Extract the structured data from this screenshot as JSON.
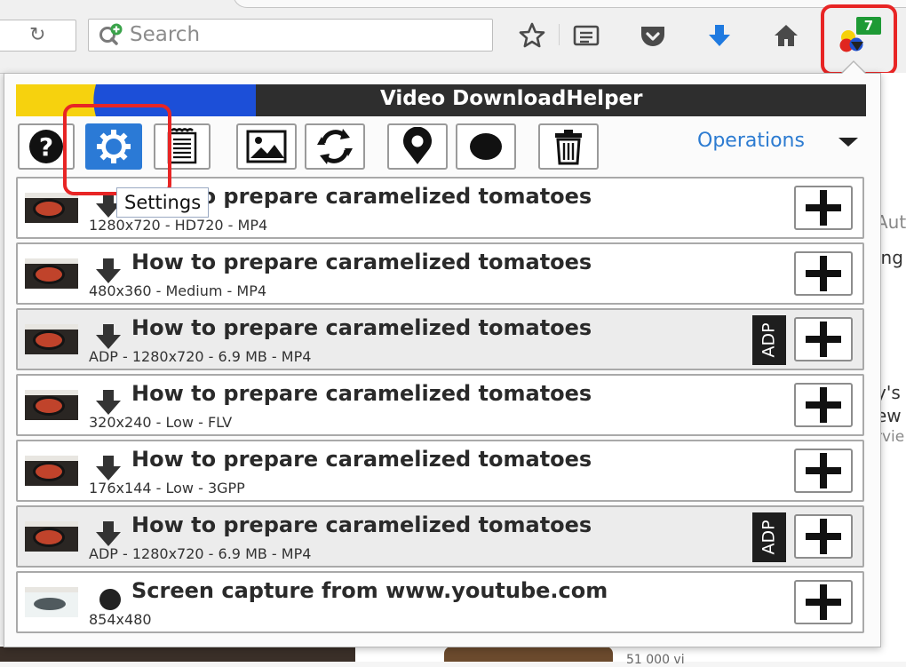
{
  "browser": {
    "search_placeholder": "Search",
    "badge_count": "7",
    "background_text": [
      "Aut",
      "ing",
      "y's",
      "ew",
      "rvie"
    ],
    "bottom_text": "51 000 vi"
  },
  "popup": {
    "title": "Video DownloadHelper",
    "operations_label": "Operations",
    "tooltip": "Settings",
    "toolbar_icons": [
      "help-icon",
      "settings-icon",
      "log-icon",
      "image-icon",
      "convert-icon",
      "location-icon",
      "record-icon",
      "trash-icon"
    ],
    "adp_label": "ADP",
    "items": [
      {
        "title": "How to prepare caramelized tomatoes",
        "meta": "1280x720 - HD720 - MP4",
        "kind": "download",
        "adp": false,
        "shaded": false
      },
      {
        "title": "How to prepare caramelized tomatoes",
        "meta": "480x360 - Medium - MP4",
        "kind": "download",
        "adp": false,
        "shaded": false
      },
      {
        "title": "How to prepare caramelized tomatoes",
        "meta": "ADP - 1280x720 - 6.9 MB - MP4",
        "kind": "download",
        "adp": true,
        "shaded": true
      },
      {
        "title": "How to prepare caramelized tomatoes",
        "meta": "320x240 - Low - FLV",
        "kind": "download",
        "adp": false,
        "shaded": false
      },
      {
        "title": "How to prepare caramelized tomatoes",
        "meta": "176x144 - Low - 3GPP",
        "kind": "download",
        "adp": false,
        "shaded": false
      },
      {
        "title": "How to prepare caramelized tomatoes",
        "meta": "ADP - 1280x720 - 6.9 MB - MP4",
        "kind": "download",
        "adp": true,
        "shaded": true
      },
      {
        "title": "Screen capture from www.youtube.com",
        "meta": "854x480",
        "kind": "capture",
        "adp": false,
        "shaded": false
      }
    ]
  },
  "colors": {
    "accent": "#2b7ad6",
    "highlight": "#e82525",
    "badge": "#1e9a35"
  }
}
